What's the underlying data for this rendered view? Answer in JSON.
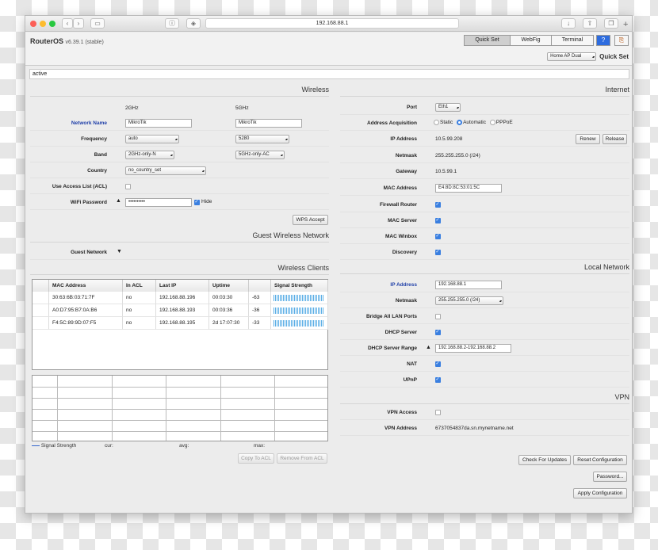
{
  "browser": {
    "url": "192.168.88.1"
  },
  "header": {
    "product": "RouterOS",
    "version": "v6.39.1 (stable)",
    "tabs": [
      "Quick Set",
      "WebFig",
      "Terminal"
    ],
    "mode_select": "Home AP Dual",
    "quick_set_label": "Quick Set"
  },
  "status": "active",
  "wireless": {
    "title": "Wireless",
    "band_2": "2GHz",
    "band_5": "5GHz",
    "network_name_label": "Network Name",
    "network_name_2": "MikroTik",
    "network_name_5": "MikroTik",
    "frequency_label": "Frequency",
    "frequency_2": "auto",
    "frequency_5": "5280",
    "band_label": "Band",
    "band_2_value": "2GHz-only-N",
    "band_5_value": "5GHz-only-AC",
    "country_label": "Country",
    "country": "no_country_set",
    "acl_label": "Use Access List (ACL)",
    "password_label": "WiFi Password",
    "password": "••••••••••",
    "hide_label": "Hide",
    "wps_button": "WPS Accept"
  },
  "guest": {
    "title": "Guest Wireless Network",
    "label": "Guest Network"
  },
  "clients": {
    "title": "Wireless Clients",
    "headers": [
      "MAC Address",
      "In ACL",
      "Last IP",
      "Uptime",
      "",
      "Signal Strength"
    ],
    "rows": [
      [
        "30:63:6B:03:71:7F",
        "no",
        "192.168.88.196",
        "00:03:30",
        "-63"
      ],
      [
        "A0:D7:95:B7:0A:B6",
        "no",
        "192.168.88.193",
        "00:03:36",
        "-36"
      ],
      [
        "F4:5C:89:9D:07:F5",
        "no",
        "192.168.88.195",
        "2d 17:07:30",
        "-33"
      ]
    ],
    "legend": {
      "series": "Signal Strength",
      "cur": "cur:",
      "avg": "avg:",
      "max": "max:"
    },
    "copy_button": "Copy To ACL",
    "remove_button": "Remove From ACL"
  },
  "internet": {
    "title": "Internet",
    "port_label": "Port",
    "port": "Eth1",
    "acq_label": "Address Acquisition",
    "acq_options": [
      "Static",
      "Automatic",
      "PPPoE"
    ],
    "ip_label": "IP Address",
    "ip": "10.5.99.208",
    "renew_button": "Renew",
    "release_button": "Release",
    "netmask_label": "Netmask",
    "netmask": "255.255.255.0 (/24)",
    "gateway_label": "Gateway",
    "gateway": "10.5.99.1",
    "mac_label": "MAC Address",
    "mac": "E4:8D:8C:53:01:5C",
    "firewall_label": "Firewall Router",
    "mac_server_label": "MAC Server",
    "mac_winbox_label": "MAC Winbox",
    "discovery_label": "Discovery"
  },
  "local": {
    "title": "Local Network",
    "ip_label": "IP Address",
    "ip": "192.168.88.1",
    "netmask_label": "Netmask",
    "netmask": "255.255.255.0 (/24)",
    "bridge_label": "Bridge All LAN Ports",
    "dhcp_label": "DHCP Server",
    "range_label": "DHCP Server Range",
    "range": "192.168.88.2-192.168.88.2",
    "nat_label": "NAT",
    "upnp_label": "UPnP"
  },
  "vpn": {
    "title": "VPN",
    "access_label": "VPN Access",
    "address_label": "VPN Address",
    "address": "6737054837da.sn.mynetname.net"
  },
  "actions": {
    "check_updates": "Check For Updates",
    "reset": "Reset Configuration",
    "password": "Password...",
    "apply": "Apply Configuration"
  }
}
